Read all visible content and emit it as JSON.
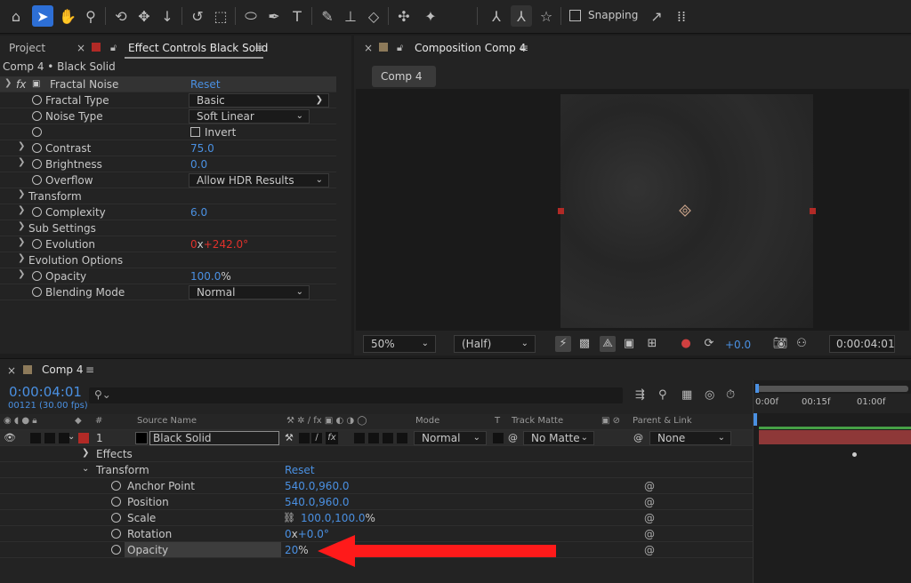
{
  "toolbar": {
    "snapping_label": "Snapping"
  },
  "effect_controls": {
    "tab_project": "Project",
    "tab_title": "Effect Controls Black Solid",
    "layer_path": "Comp 4 • Black Solid",
    "effect_name": "Fractal Noise",
    "reset_label": "Reset",
    "rows": [
      {
        "label": "Fractal Type",
        "value": "Basic"
      },
      {
        "label": "Noise Type",
        "value": "Soft Linear"
      },
      {
        "label": "Invert",
        "value": ""
      },
      {
        "label": "Contrast",
        "value": "75.0"
      },
      {
        "label": "Brightness",
        "value": "0.0"
      },
      {
        "label": "Overflow",
        "value": "Allow HDR Results"
      },
      {
        "label": "Transform",
        "value": ""
      },
      {
        "label": "Complexity",
        "value": "6.0"
      },
      {
        "label": "Sub Settings",
        "value": ""
      },
      {
        "label": "Evolution",
        "value_rev": "0",
        "value_x": "x",
        "value_deg": "+242.0°"
      },
      {
        "label": "Evolution Options",
        "value": ""
      },
      {
        "label": "Opacity",
        "value_num": "100.0",
        "value_unit": "%"
      },
      {
        "label": "Blending Mode",
        "value": "Normal"
      }
    ]
  },
  "composition": {
    "tab_title": "Composition Comp 4",
    "comp_chip": "Comp 4",
    "zoom": "50%",
    "resolution": "(Half)",
    "exposure": "+0.0",
    "timecode": "0:00:04:01"
  },
  "timeline": {
    "tab_title": "Comp 4",
    "timecode": "0:00:04:01",
    "frames": "00121 (30.00 fps)",
    "search_placeholder": "",
    "columns": {
      "num": "#",
      "source_name": "Source Name",
      "mode": "Mode",
      "t": "T",
      "track_matte": "Track Matte",
      "parent": "Parent & Link"
    },
    "ruler": [
      "0:00f",
      "00:15f",
      "01:00f"
    ],
    "layer": {
      "index": "1",
      "name": "Black Solid",
      "mode": "Normal",
      "matte": "No Matte",
      "parent": "None"
    },
    "groups": {
      "effects": "Effects",
      "transform": "Transform",
      "reset": "Reset"
    },
    "props": [
      {
        "label": "Anchor Point",
        "value": "540.0,960.0"
      },
      {
        "label": "Position",
        "value": "540.0,960.0"
      },
      {
        "label": "Scale",
        "value": "100.0,100.0",
        "unit": "%"
      },
      {
        "label": "Rotation",
        "value_rev": "0",
        "value_x": "x",
        "value_deg": "+0.0°"
      },
      {
        "label": "Opacity",
        "value": "20",
        "unit": "%"
      }
    ]
  },
  "colors": {
    "accent_blue": "#4a90e2",
    "red_arrow": "#ff1a1a",
    "layer_label_red": "#b12a26"
  }
}
